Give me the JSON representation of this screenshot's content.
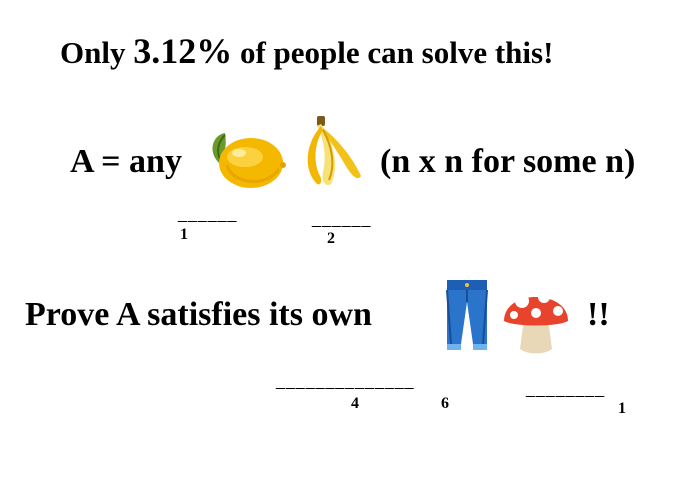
{
  "headline": {
    "prefix": "Only",
    "percent": "3.12%",
    "suffix": "of people can solve this!"
  },
  "statement": {
    "lhs": "A = any",
    "rhs": "(n x n for some n)",
    "emoji": [
      "lemon-icon",
      "banana-icon"
    ]
  },
  "hint_row_1": {
    "dashes_left": "______",
    "digit_left": "1",
    "dashes_right": "______",
    "digit_right": "2"
  },
  "task": {
    "text": "Prove A satisfies its own",
    "ending": "!!",
    "emoji": [
      "jeans-icon",
      "mushroom-icon"
    ]
  },
  "hint_row_2": {
    "dashes_left": "______________",
    "digit_a": "4",
    "digit_b": "6",
    "dashes_right": "________",
    "digit_c": "1"
  }
}
